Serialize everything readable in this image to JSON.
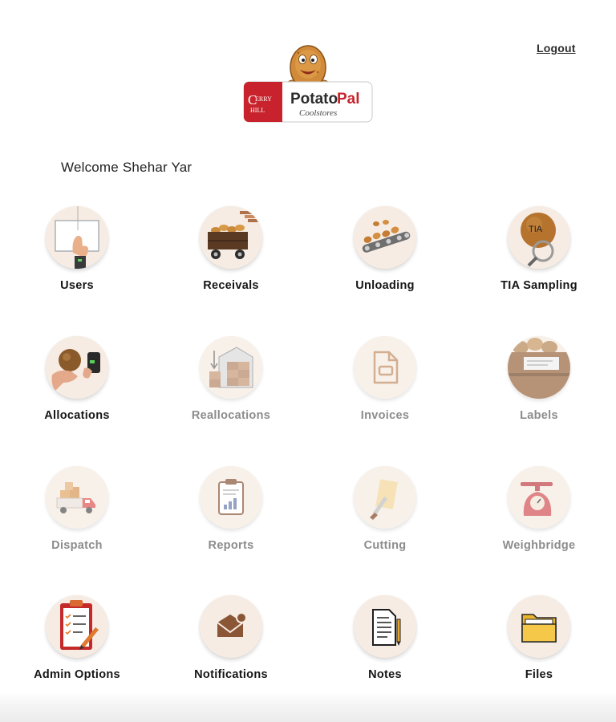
{
  "header": {
    "logout_label": "Logout",
    "brand": {
      "left_word": "CHERRY HILL",
      "name_part1": "Potato",
      "name_part2": "Pal",
      "tagline": "Coolstores"
    }
  },
  "welcome_text": "Welcome Shehar Yar",
  "colors": {
    "brand_red": "#c8232c",
    "tile_bg": "#f6ece3",
    "disabled_text": "#8c8c8c"
  },
  "tiles": [
    {
      "label": "Users",
      "icon": "users-icon",
      "enabled": true
    },
    {
      "label": "Receivals",
      "icon": "receivals-cart-icon",
      "enabled": true
    },
    {
      "label": "Unloading",
      "icon": "conveyor-icon",
      "enabled": true
    },
    {
      "label": "TIA Sampling",
      "icon": "tia-sampling-icon",
      "enabled": true,
      "icon_text": "TIA"
    },
    {
      "label": "Allocations",
      "icon": "allocations-icon",
      "enabled": true
    },
    {
      "label": "Reallocations",
      "icon": "warehouse-boxes-icon",
      "enabled": false
    },
    {
      "label": "Invoices",
      "icon": "document-icon",
      "enabled": false
    },
    {
      "label": "Labels",
      "icon": "potato-crate-label-icon",
      "enabled": false
    },
    {
      "label": "Dispatch",
      "icon": "delivery-truck-icon",
      "enabled": false
    },
    {
      "label": "Reports",
      "icon": "clipboard-chart-icon",
      "enabled": false
    },
    {
      "label": "Cutting",
      "icon": "cutting-icon",
      "enabled": false
    },
    {
      "label": "Weighbridge",
      "icon": "scale-icon",
      "enabled": false
    },
    {
      "label": "Admin Options",
      "icon": "checklist-icon",
      "enabled": true
    },
    {
      "label": "Notifications",
      "icon": "mail-notification-icon",
      "enabled": true
    },
    {
      "label": "Notes",
      "icon": "notes-icon",
      "enabled": true
    },
    {
      "label": "Files",
      "icon": "folder-icon",
      "enabled": true
    }
  ]
}
